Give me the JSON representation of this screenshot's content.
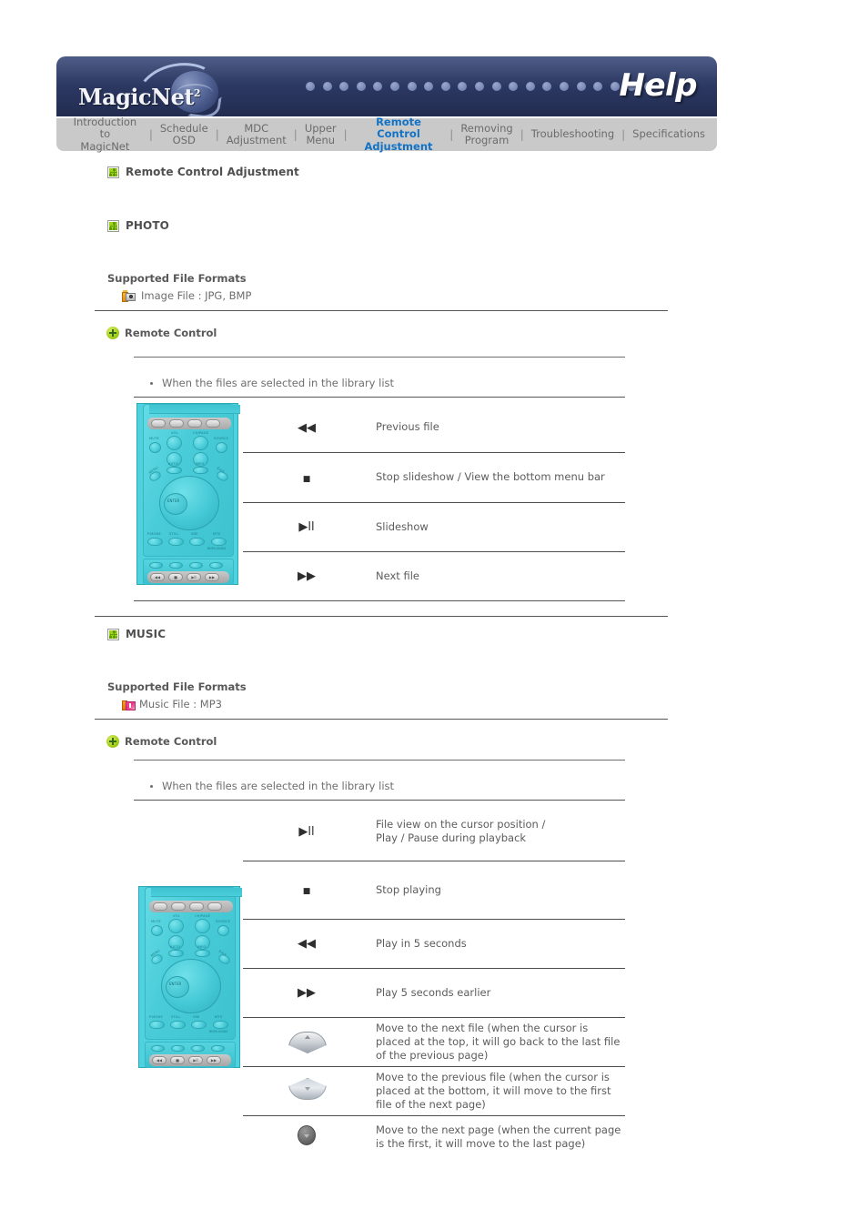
{
  "header": {
    "logo_text": "MagicNet",
    "logo_superscript": "2",
    "title": "Help",
    "dot_count": 21,
    "bg_color": "#2d3a64",
    "accent_color": "#1273c6"
  },
  "nav": {
    "tabs": [
      {
        "label": "Introduction to\nMagicNet",
        "active": false
      },
      {
        "label": "Schedule\nOSD",
        "active": false
      },
      {
        "label": "MDC\nAdjustment",
        "active": false
      },
      {
        "label": "Upper\nMenu",
        "active": false
      },
      {
        "label": "Remote Control\nAdjustment",
        "active": true
      },
      {
        "label": "Removing\nProgram",
        "active": false
      },
      {
        "label": "Troubleshooting",
        "active": false
      },
      {
        "label": "Specifications",
        "active": false
      }
    ],
    "separator": "|"
  },
  "page_title": "Remote Control Adjustment",
  "sections": [
    {
      "id": "photo",
      "heading": "PHOTO",
      "heading_icon": "sitemap-icon",
      "formats_label": "Supported File Formats",
      "formats_icon": "photo-file-icon",
      "formats_value": "Image File : JPG, BMP",
      "remote_label": "Remote Control",
      "remote_icon": "plus-icon",
      "bullet_note": "When the files are selected in the library list",
      "rows": [
        {
          "icon": "rewind-icon",
          "glyph": "◀◀",
          "desc": "Previous file"
        },
        {
          "icon": "stop-icon",
          "glyph": "■",
          "desc": "Stop slideshow / View the bottom menu bar"
        },
        {
          "icon": "play-pause-icon",
          "glyph": "▶ll",
          "desc": "Slideshow"
        },
        {
          "icon": "fast-forward-icon",
          "glyph": "▶▶",
          "desc": "Next file"
        }
      ]
    },
    {
      "id": "music",
      "heading": "MUSIC",
      "heading_icon": "sitemap-icon",
      "formats_label": "Supported File Formats",
      "formats_icon": "music-file-icon",
      "formats_value": "Music File : MP3",
      "remote_label": "Remote Control",
      "remote_icon": "plus-icon",
      "bullet_note": "When the files are selected in the library list",
      "rows": [
        {
          "icon": "play-pause-icon",
          "glyph": "▶ll",
          "desc": "File view on the cursor position /\nPlay / Pause during playback"
        },
        {
          "icon": "stop-icon",
          "glyph": "■",
          "desc": "Stop playing"
        },
        {
          "icon": "rewind-icon",
          "glyph": "◀◀",
          "desc": "Play in 5 seconds"
        },
        {
          "icon": "fast-forward-icon",
          "glyph": "▶▶",
          "desc": "Play 5 seconds earlier"
        },
        {
          "icon": "curve-up-button-icon",
          "glyph": "",
          "desc": "Move to the next file (when the cursor is placed at the top, it will go back to the last file of the previous page)"
        },
        {
          "icon": "curve-down-button-icon",
          "glyph": "",
          "desc": "Move to the previous file (when the cursor is placed at the bottom, it will move to the first file of the next page)"
        },
        {
          "icon": "round-button-icon",
          "glyph": "",
          "desc": "Move to the next page (when the current page is the first, it will move to the last page)"
        }
      ]
    }
  ],
  "remote_image": {
    "name": "samsung-remote-control",
    "color": "#4fd2dd",
    "labels": {
      "mute": "MUTE",
      "vol": "VOL",
      "ch_page": "CH/PAGE",
      "source": "SOURCE",
      "auto": "AUTO",
      "info": "INFO",
      "menu": "MENU",
      "exit": "EXIT",
      "enter": "ENTER",
      "pmode": "P.MODE",
      "still": "STILL",
      "sre": "SRE",
      "mts": "MTS",
      "model": "BN59-00464"
    }
  }
}
